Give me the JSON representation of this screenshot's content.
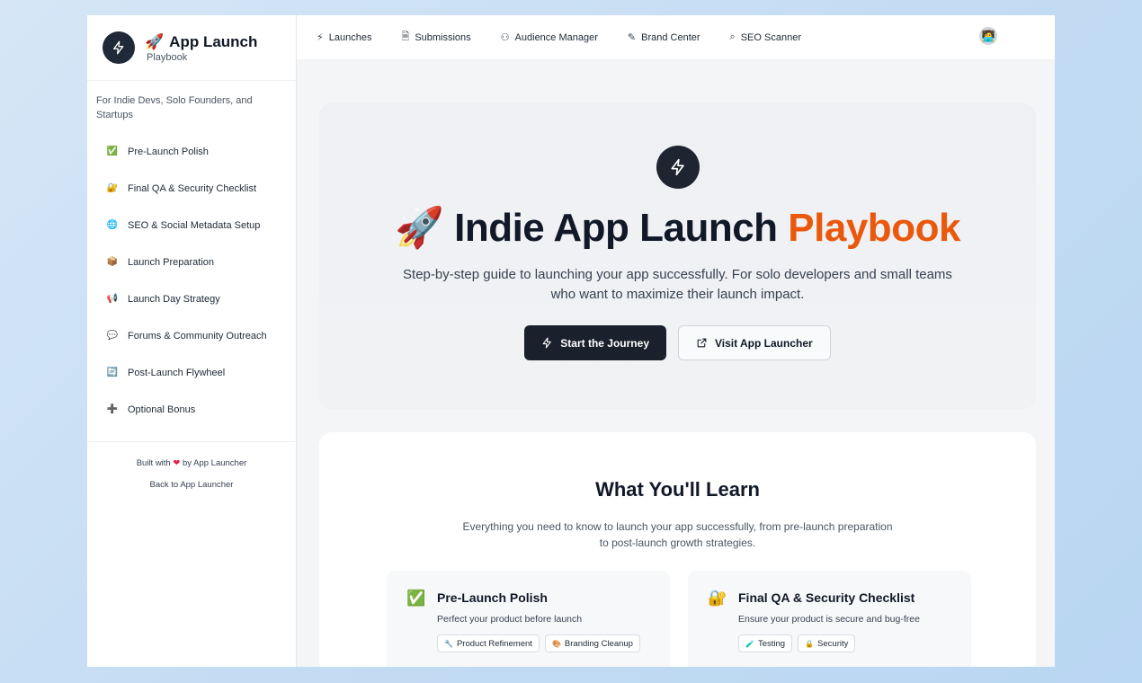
{
  "brand": {
    "emoji": "🚀",
    "title": "App Launch",
    "subtitle": "Playbook",
    "badge_icon": "bolt-icon"
  },
  "sidebar": {
    "tagline": "For Indie Devs, Solo Founders, and Startups",
    "items": [
      {
        "emoji": "✅",
        "label": "Pre-Launch Polish"
      },
      {
        "emoji": "🔐",
        "label": "Final QA & Security Checklist"
      },
      {
        "emoji": "🌐",
        "label": "SEO & Social Metadata Setup"
      },
      {
        "emoji": "📦",
        "label": "Launch Preparation"
      },
      {
        "emoji": "📢",
        "label": "Launch Day Strategy"
      },
      {
        "emoji": "💬",
        "label": "Forums & Community Outreach"
      },
      {
        "emoji": "🔄",
        "label": "Post-Launch Flywheel"
      },
      {
        "emoji": "➕",
        "label": "Optional Bonus"
      }
    ],
    "footer": {
      "built_prefix": "Built with",
      "heart": "❤",
      "built_suffix": "by App Launcher",
      "back_link": "Back to App Launcher"
    }
  },
  "topnav": {
    "tabs": [
      {
        "icon": "⚡",
        "label": "Launches"
      },
      {
        "icon": "🗎",
        "label": "Submissions"
      },
      {
        "icon": "⚇",
        "label": "Audience Manager"
      },
      {
        "icon": "✎",
        "label": "Brand Center"
      },
      {
        "icon": "⌕",
        "label": "SEO Scanner"
      }
    ],
    "avatar": "🧑‍💻"
  },
  "hero": {
    "title_emoji": "🚀",
    "title_main": "Indie App Launch",
    "title_accent": "Playbook",
    "subtitle": "Step-by-step guide to launching your app successfully. For solo developers and small teams who want to maximize their launch impact.",
    "primary_button": "Start the Journey",
    "secondary_button": "Visit App Launcher"
  },
  "learn": {
    "title": "What You'll Learn",
    "subtitle": "Everything you need to know to launch your app successfully, from pre-launch preparation to post-launch growth strategies.",
    "cards": [
      {
        "emoji": "✅",
        "title": "Pre-Launch Polish",
        "desc": "Perfect your product before launch",
        "chips": [
          {
            "icon": "🔧",
            "label": "Product Refinement"
          },
          {
            "icon": "🎨",
            "label": "Branding Cleanup"
          }
        ]
      },
      {
        "emoji": "🔐",
        "title": "Final QA & Security Checklist",
        "desc": "Ensure your product is secure and bug-free",
        "chips": [
          {
            "icon": "🧪",
            "label": "Testing"
          },
          {
            "icon": "🔒",
            "label": "Security"
          }
        ]
      }
    ]
  },
  "colors": {
    "accent": "#ea580c",
    "dark": "#1a202c"
  }
}
